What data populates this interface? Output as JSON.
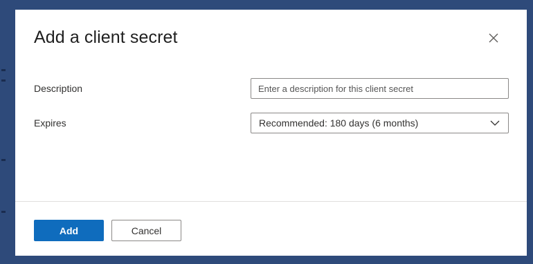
{
  "dialog": {
    "title": "Add a client secret",
    "close_icon": "close-icon"
  },
  "form": {
    "description": {
      "label": "Description",
      "placeholder": "Enter a description for this client secret",
      "value": ""
    },
    "expires": {
      "label": "Expires",
      "selected": "Recommended: 180 days (6 months)",
      "icon": "chevron-down-icon"
    }
  },
  "footer": {
    "add_label": "Add",
    "cancel_label": "Cancel"
  },
  "colors": {
    "primary": "#0f6cbd",
    "backdrop": "#2e4a7a"
  }
}
